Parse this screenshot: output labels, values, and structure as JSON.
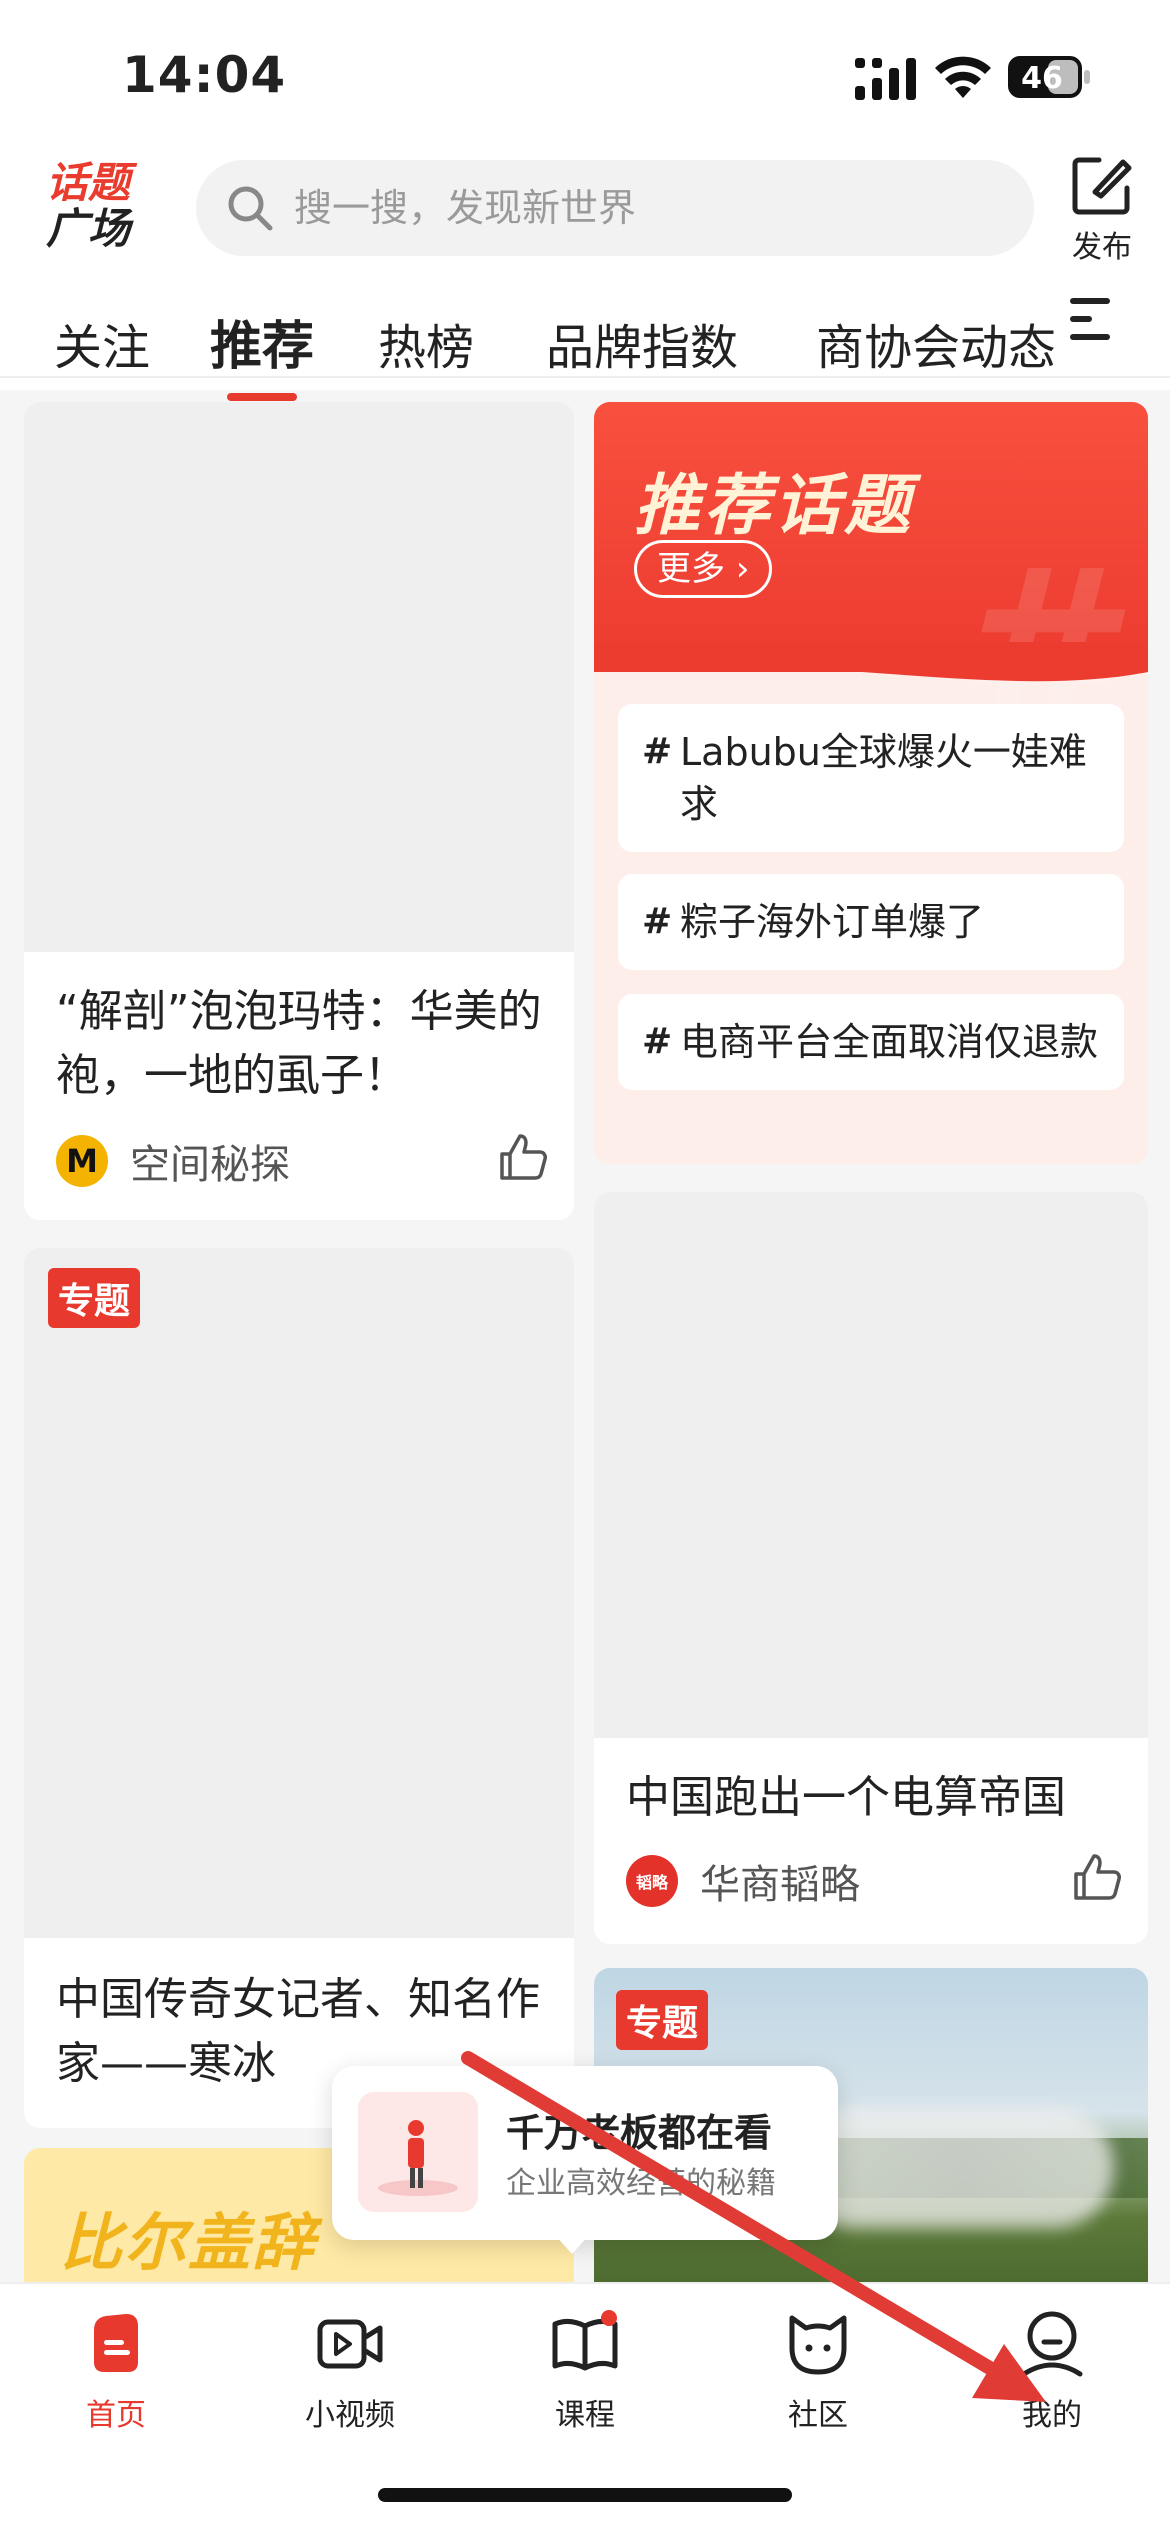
{
  "status_bar": {
    "time": "14:04",
    "battery": "46"
  },
  "header": {
    "logo_line1": "话题",
    "logo_line2": "广场",
    "search_placeholder": "搜一搜，发现新世界",
    "publish_label": "发布"
  },
  "tabs": [
    {
      "label": "关注",
      "active": false
    },
    {
      "label": "推荐",
      "active": true
    },
    {
      "label": "热榜",
      "active": false
    },
    {
      "label": "品牌指数",
      "active": false
    },
    {
      "label": "商协会动态",
      "active": false
    }
  ],
  "feed": {
    "card1": {
      "title": "“解剖”泡泡玛特：华美的袍，一地的虱子！",
      "author": "空间秘探",
      "avatar_letter": "M"
    },
    "card2": {
      "badge": "专题",
      "title": "中国传奇女记者、知名作家——寒冰"
    },
    "card3": {
      "title": "中国跑出一个电算帝国",
      "author": "华商韬略",
      "avatar_text": "韬略"
    },
    "card4": {
      "badge": "专题"
    },
    "yellow_banner": {
      "text": "比尔盖辞"
    }
  },
  "topics": {
    "heading": "推荐话题",
    "more": "更多",
    "hash_symbol": "#",
    "items": [
      "Labubu全球爆火一娃难求",
      "粽子海外订单爆了",
      "电商平台全面取消仅退款"
    ]
  },
  "popup": {
    "title": "千万老板都在看",
    "subtitle": "企业高效经营的秘籍"
  },
  "bottom_nav": [
    {
      "label": "首页",
      "icon": "home-icon",
      "active": true
    },
    {
      "label": "小视频",
      "icon": "video-icon",
      "active": false
    },
    {
      "label": "课程",
      "icon": "book-icon",
      "active": false
    },
    {
      "label": "社区",
      "icon": "cat-icon",
      "active": false
    },
    {
      "label": "我的",
      "icon": "profile-icon",
      "active": false
    }
  ],
  "colors": {
    "accent": "#e8392e",
    "topic_bg": "#fdeeea",
    "banner_yellow": "#ffe9a6"
  }
}
